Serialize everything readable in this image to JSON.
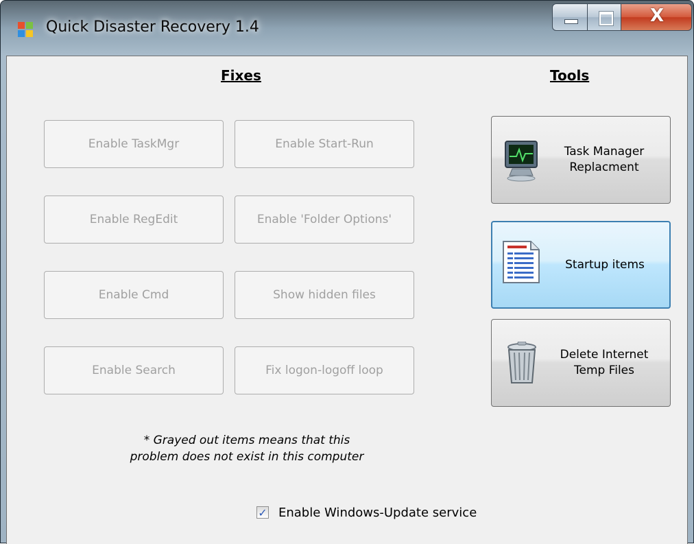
{
  "window": {
    "title": "Quick Disaster Recovery 1.4",
    "close_glyph": "X"
  },
  "sections": {
    "fixes_title": "Fixes",
    "tools_title": "Tools"
  },
  "fixes": [
    {
      "label": "Enable TaskMgr",
      "enabled": false
    },
    {
      "label": "Enable Start-Run",
      "enabled": false
    },
    {
      "label": "Enable RegEdit",
      "enabled": false
    },
    {
      "label": "Enable 'Folder Options'",
      "enabled": false
    },
    {
      "label": "Enable Cmd",
      "enabled": false
    },
    {
      "label": "Show hidden files",
      "enabled": false
    },
    {
      "label": "Enable Search",
      "enabled": false
    },
    {
      "label": "Fix logon-logoff loop",
      "enabled": false
    }
  ],
  "tools": [
    {
      "label_line1": "Task Manager",
      "label_line2": "Replacment",
      "icon": "monitor-icon"
    },
    {
      "label_line1": "Startup items",
      "label_line2": "",
      "icon": "document-list-icon",
      "focused": true
    },
    {
      "label_line1": "Delete Internet",
      "label_line2": "Temp Files",
      "icon": "trash-can-icon"
    }
  ],
  "note": {
    "line1": "* Grayed out items means that this",
    "line2": "problem does not exist in this computer"
  },
  "windows_update": {
    "label": "Enable Windows-Update service",
    "checked": true,
    "check_glyph": "✓"
  },
  "colors": {
    "disabled_text": "#a0a0a0",
    "focus_border": "#3c7fb1",
    "close_red": "#c23b1f"
  }
}
